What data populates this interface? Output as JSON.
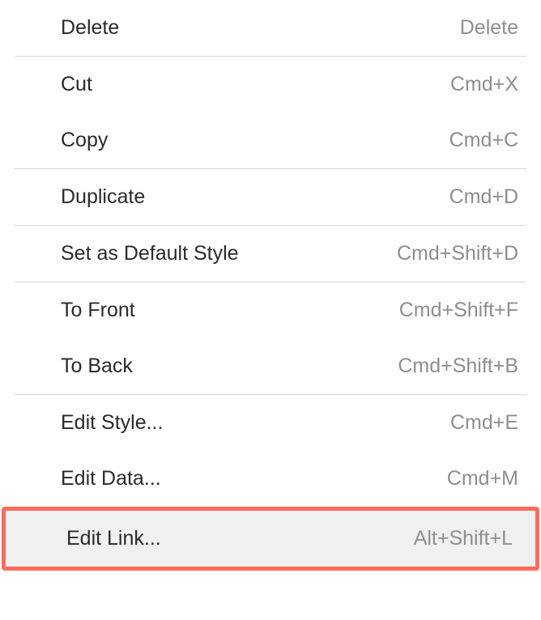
{
  "menu": {
    "groups": [
      [
        {
          "id": "delete",
          "label": "Delete",
          "shortcut": "Delete"
        }
      ],
      [
        {
          "id": "cut",
          "label": "Cut",
          "shortcut": "Cmd+X"
        },
        {
          "id": "copy",
          "label": "Copy",
          "shortcut": "Cmd+C"
        }
      ],
      [
        {
          "id": "duplicate",
          "label": "Duplicate",
          "shortcut": "Cmd+D"
        }
      ],
      [
        {
          "id": "set-default-style",
          "label": "Set as Default Style",
          "shortcut": "Cmd+Shift+D"
        }
      ],
      [
        {
          "id": "to-front",
          "label": "To Front",
          "shortcut": "Cmd+Shift+F"
        },
        {
          "id": "to-back",
          "label": "To Back",
          "shortcut": "Cmd+Shift+B"
        }
      ],
      [
        {
          "id": "edit-style",
          "label": "Edit Style...",
          "shortcut": "Cmd+E"
        },
        {
          "id": "edit-data",
          "label": "Edit Data...",
          "shortcut": "Cmd+M"
        },
        {
          "id": "edit-link",
          "label": "Edit Link...",
          "shortcut": "Alt+Shift+L",
          "highlighted": true
        }
      ]
    ]
  }
}
